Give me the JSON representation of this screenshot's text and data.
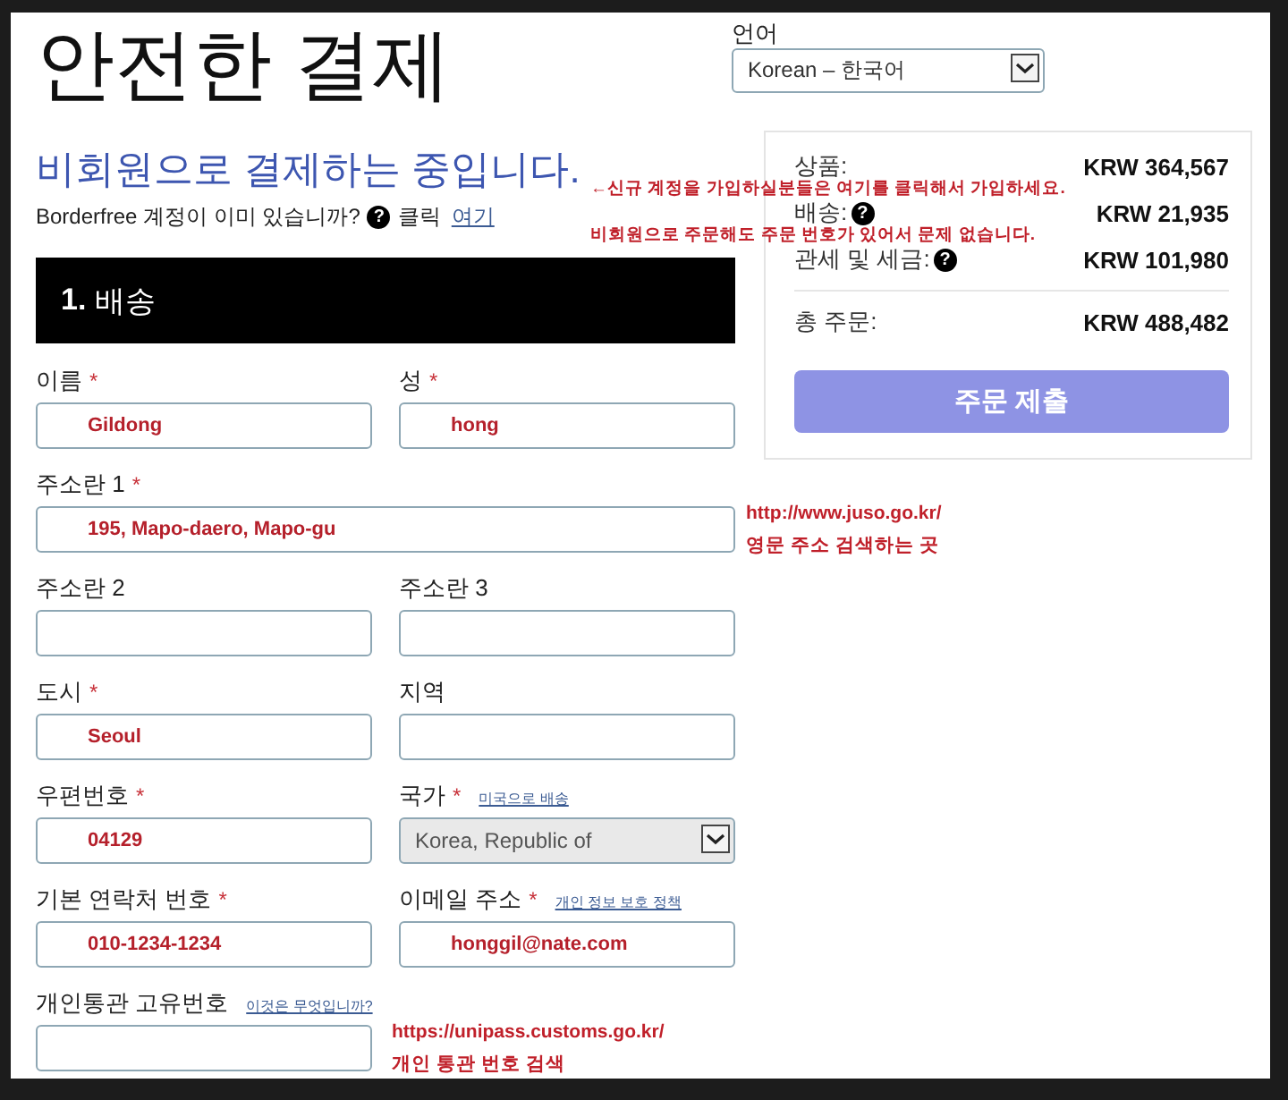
{
  "title": "안전한 결제",
  "language": {
    "label": "언어",
    "value": "Korean – 한국어"
  },
  "guest": {
    "heading": "비회원으로 결제하는 중입니다.",
    "question": "Borderfree 계정이 이미 있습니까?",
    "help": "?",
    "prompt": "클릭",
    "link": "여기",
    "note": [
      "←신규 계정을 가입하실분들은 여기를 클릭해서 가입하세요.",
      "비회원으로 주문해도 주문 번호가 있어서 문제 없습니다."
    ]
  },
  "section": {
    "number": "1.",
    "title": "배송"
  },
  "rows": [
    {
      "fields": [
        {
          "kind": "text",
          "label": "이름",
          "required": "*",
          "value": "Gildong"
        },
        {
          "kind": "text",
          "label": "성",
          "required": "*",
          "value": "hong"
        }
      ]
    },
    {
      "fields": [
        {
          "kind": "wide",
          "label": "주소란 1",
          "required": "*",
          "value": "195, Mapo-daero, Mapo-gu"
        }
      ],
      "note": [
        "http://www.juso.go.kr/",
        "영문 주소 검색하는 곳"
      ]
    },
    {
      "fields": [
        {
          "kind": "text",
          "label": "주소란 2"
        },
        {
          "kind": "text",
          "label": "주소란 3"
        }
      ]
    },
    {
      "fields": [
        {
          "kind": "text",
          "label": "도시",
          "required": "*",
          "value": "Seoul"
        },
        {
          "kind": "text",
          "label": "지역"
        }
      ]
    },
    {
      "fields": [
        {
          "kind": "text",
          "label": "우편번호",
          "required": "*",
          "value": "04129"
        },
        {
          "kind": "select",
          "label": "국가",
          "required": "*",
          "link": "미국으로 배송",
          "value": "Korea, Republic of",
          "disabled": true
        }
      ]
    },
    {
      "fields": [
        {
          "kind": "text",
          "label": "기본 연락처 번호",
          "required": "*",
          "value": "010-1234-1234"
        },
        {
          "kind": "text",
          "label": "이메일 주소",
          "required": "*",
          "link": "개인 정보 보호 정책",
          "value": "honggil@nate.com"
        }
      ]
    },
    {
      "fields": [
        {
          "kind": "text",
          "label": "개인통관 고유번호",
          "link": "이것은 무엇입니까?"
        }
      ],
      "note": [
        "https://unipass.customs.go.kr/",
        "개인 통관 번호 검색"
      ]
    }
  ],
  "summary": {
    "items": [
      {
        "label": "상품:",
        "amount": "KRW 364,567"
      },
      {
        "label": "배송:",
        "help": "?",
        "amount": "KRW 21,935"
      },
      {
        "label": "관세 및 세금:",
        "help": "?",
        "amount": "KRW 101,980"
      }
    ],
    "total": {
      "label": "총 주문:",
      "amount": "KRW 488,482"
    },
    "button": "주문 제출"
  }
}
